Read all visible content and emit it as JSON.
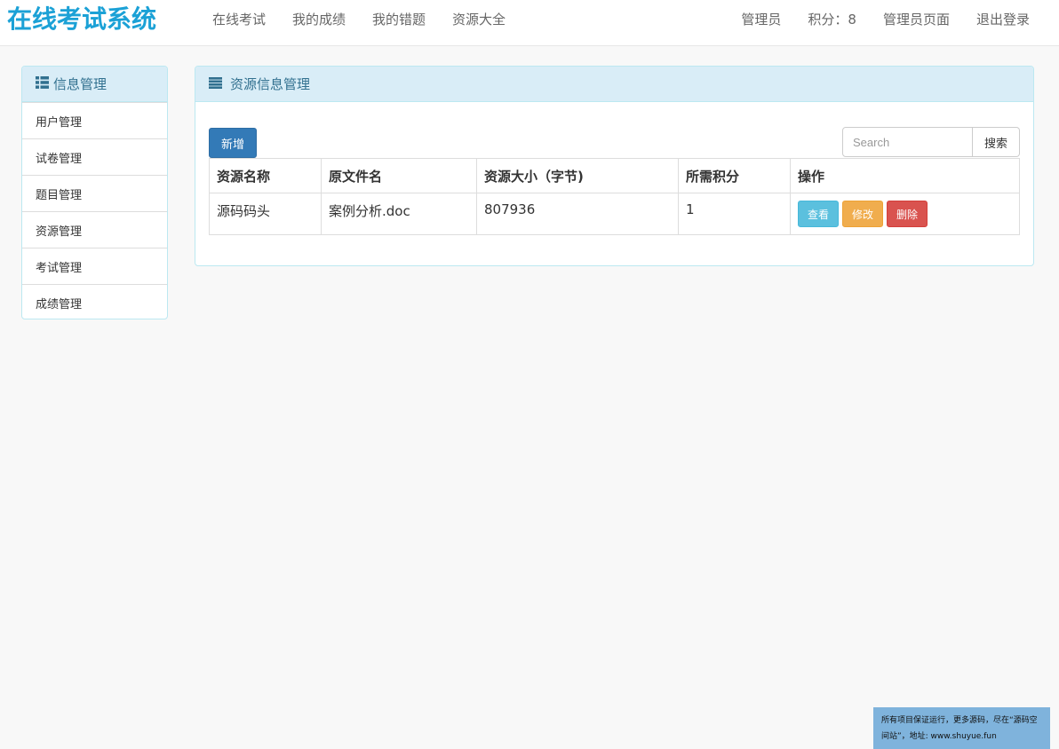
{
  "brand": "在线考试系统",
  "nav": {
    "left": [
      "在线考试",
      "我的成绩",
      "我的错题",
      "资源大全"
    ],
    "right": [
      "管理员",
      "积分：8",
      "管理员页面",
      "退出登录"
    ]
  },
  "sidebar": {
    "title": "信息管理",
    "icon": "list-icon",
    "items": [
      "用户管理",
      "试卷管理",
      "题目管理",
      "资源管理",
      "考试管理",
      "成绩管理"
    ]
  },
  "main": {
    "title": "资源信息管理",
    "icon": "bars-icon",
    "add_label": "新增",
    "search": {
      "placeholder": "Search",
      "button_label": "搜索"
    },
    "table": {
      "columns": [
        "资源名称",
        "原文件名",
        "资源大小（字节)",
        "所需积分",
        "操作"
      ],
      "rows": [
        {
          "name": "源码码头",
          "file": "案例分析.doc",
          "size": "807936",
          "points": "1"
        }
      ],
      "actions": {
        "view": "查看",
        "edit": "修改",
        "delete": "删除"
      }
    }
  },
  "footer_note": "所有项目保证运行，更多源码，尽在“源码空间站”，地址: www.shuyue.fun",
  "colors": {
    "brand": "#1ba1d6",
    "panel_heading_bg": "#d9edf7",
    "primary": "#337ab7",
    "info": "#5bc0de",
    "warning": "#f0ad4e",
    "danger": "#d9534f"
  }
}
